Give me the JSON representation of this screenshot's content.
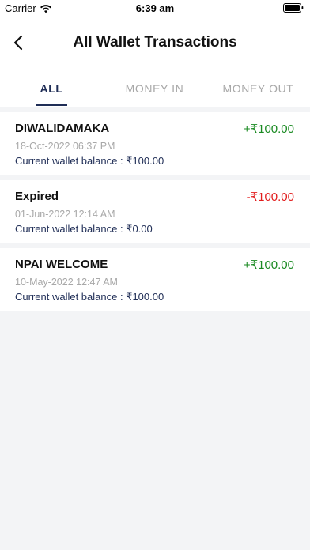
{
  "status_bar": {
    "carrier": "Carrier",
    "time": "6:39 am"
  },
  "header": {
    "title": "All Wallet Transactions"
  },
  "tabs": [
    {
      "label": "ALL",
      "active": true
    },
    {
      "label": "MONEY IN",
      "active": false
    },
    {
      "label": "MONEY OUT",
      "active": false
    }
  ],
  "transactions": [
    {
      "name": "DIWALIDAMAKA",
      "amount": "+₹100.00",
      "type": "credit",
      "date": "18-Oct-2022 06:37 PM",
      "balance": "Current wallet balance : ₹100.00"
    },
    {
      "name": "Expired",
      "amount": "-₹100.00",
      "type": "debit",
      "date": "01-Jun-2022 12:14 AM",
      "balance": "Current wallet balance : ₹0.00"
    },
    {
      "name": "NPAI WELCOME",
      "amount": "+₹100.00",
      "type": "credit",
      "date": "10-May-2022 12:47 AM",
      "balance": "Current wallet balance : ₹100.00"
    }
  ],
  "colors": {
    "credit": "#1a8a22",
    "debit": "#e21c1c",
    "accent": "#1f2d56"
  }
}
